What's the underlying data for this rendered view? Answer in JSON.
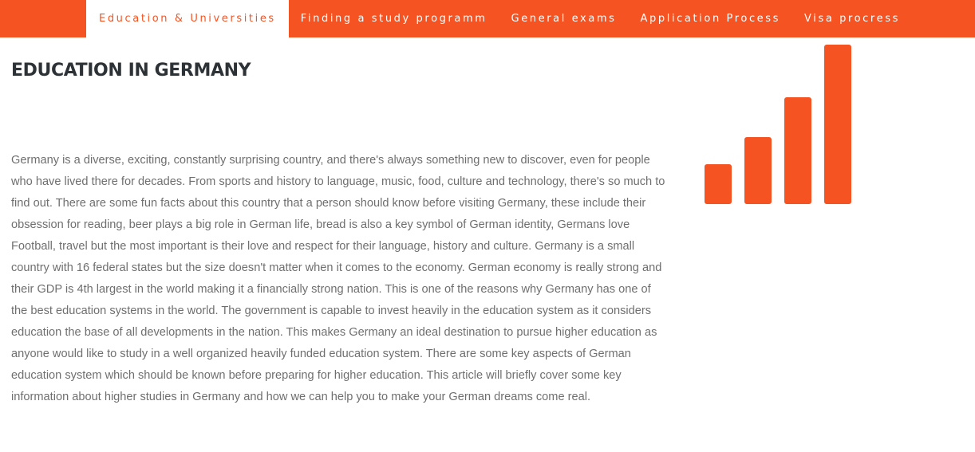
{
  "colors": {
    "accent": "#f65322",
    "title": "#2d3236",
    "text": "#6f6f6f"
  },
  "nav": {
    "items": [
      {
        "label": "Education & Universities",
        "active": true
      },
      {
        "label": "Finding a study programm",
        "active": false
      },
      {
        "label": "General exams",
        "active": false
      },
      {
        "label": "Application Process",
        "active": false
      },
      {
        "label": "Visa procress",
        "active": false
      }
    ]
  },
  "main": {
    "title": "EDUCATION IN GERMANY",
    "paragraph": "Germany is a diverse, exciting, constantly surprising country, and there's always something new to discover, even for people who have lived there for decades. From sports and history to language, music, food, culture and technology, there's so much to find out. There are some fun facts about this country that a person should know before visiting Germany, these include their obsession for reading, beer plays a big role in German life, bread is also a key symbol of German identity, Germans love Football, travel but the most important is their love and respect for their language, history and culture. Germany is a small country with 16 federal states but the size doesn't matter when it comes to the economy. German economy is really strong and their GDP is 4th largest in the world making it a financially strong nation. This is one of the reasons why Germany has one of the best education systems in the world. The government is capable to invest heavily in the education system as it considers education the base of all developments in the nation. This makes Germany an ideal destination to pursue higher education as anyone would like to study in a well organized heavily funded education system. There are some key aspects of German education system which should be known before preparing for higher education. This article will briefly cover some key information about higher studies in Germany and how we can help you to make your German dreams come real."
  },
  "graphic": {
    "icon": "signal-bars-icon"
  }
}
